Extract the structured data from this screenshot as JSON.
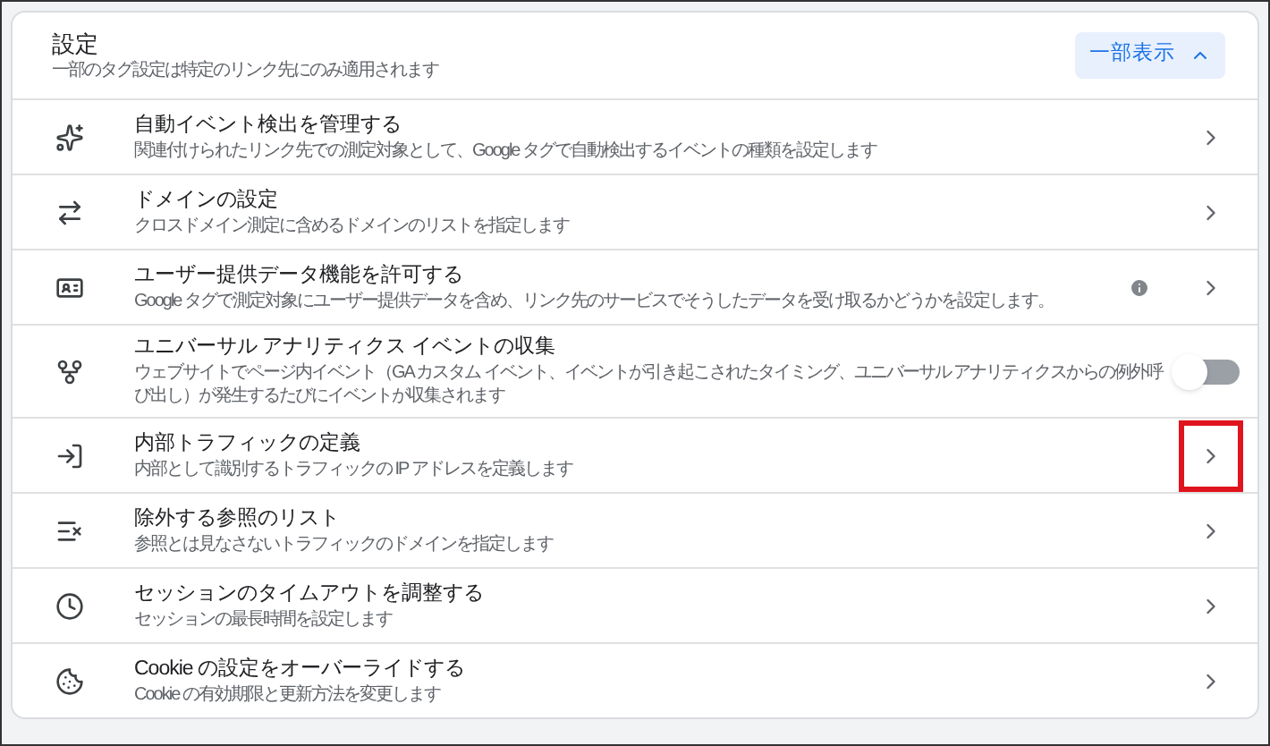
{
  "header": {
    "title": "設定",
    "subtitle": "一部のタグ設定は特定のリンク先にのみ適用されます",
    "toggle_button": "一部表示",
    "expanded": true
  },
  "items": [
    {
      "kind": "link",
      "title": "自動イベント検出を管理する",
      "description": "関連付けられたリンク先での測定対象として、Google タグで自動検出するイベントの種類を設定します",
      "info": false,
      "highlighted": false
    },
    {
      "kind": "link",
      "title": "ドメインの設定",
      "description": "クロスドメイン測定に含めるドメインのリストを指定します",
      "info": false,
      "highlighted": false
    },
    {
      "kind": "link",
      "title": "ユーザー提供データ機能を許可する",
      "description": "Google タグで測定対象にユーザー提供データを含め、リンク先のサービスでそうしたデータを受け取るかどうかを設定します。",
      "info": true,
      "highlighted": false
    },
    {
      "kind": "toggle",
      "title": "ユニバーサル アナリティクス イベントの収集",
      "description": "ウェブサイトでページ内イベント（GA カスタム イベント、イベントが引き起こされたタイミング、ユニバーサル アナリティクスからの例外呼び出し）が発生するたびにイベントが収集されます",
      "on": false,
      "info": false
    },
    {
      "kind": "link",
      "title": "内部トラフィックの定義",
      "description": "内部として識別するトラフィックの IP アドレスを定義します",
      "info": false,
      "highlighted": true
    },
    {
      "kind": "link",
      "title": "除外する参照のリスト",
      "description": "参照とは見なさないトラフィックのドメインを指定します",
      "info": false,
      "highlighted": false
    },
    {
      "kind": "link",
      "title": "セッションのタイムアウトを調整する",
      "description": "セッションの最長時間を設定します",
      "info": false,
      "highlighted": false
    },
    {
      "kind": "link",
      "title": "Cookie の設定をオーバーライドする",
      "description": "Cookie の有効期限と更新方法を変更します",
      "info": false,
      "highlighted": false
    }
  ]
}
